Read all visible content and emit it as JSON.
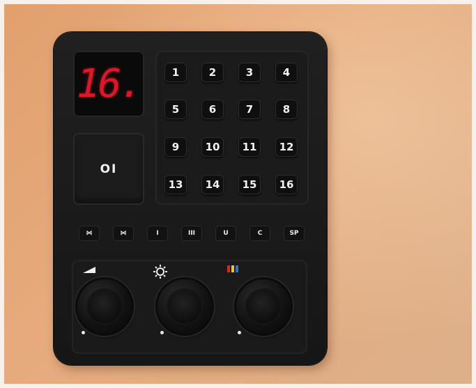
{
  "display": {
    "channel": "16."
  },
  "power": {
    "label": "OI"
  },
  "keypad": {
    "keys": [
      "1",
      "2",
      "3",
      "4",
      "5",
      "6",
      "7",
      "8",
      "9",
      "10",
      "11",
      "12",
      "13",
      "14",
      "15",
      "16"
    ]
  },
  "function_keys": [
    {
      "label": "⋈",
      "icon": "bowtie-icon"
    },
    {
      "label": "⋈",
      "icon": "bowtie-icon"
    },
    {
      "label": "I"
    },
    {
      "label": "III"
    },
    {
      "label": "U"
    },
    {
      "label": "C"
    },
    {
      "label": "SP"
    }
  ],
  "knobs": [
    {
      "icon": "volume-ramp-icon"
    },
    {
      "icon": "brightness-sun-icon"
    },
    {
      "icon": "color-bars-icon",
      "colors": [
        "#d42a1e",
        "#e9c532",
        "#2f6fbf"
      ]
    }
  ]
}
